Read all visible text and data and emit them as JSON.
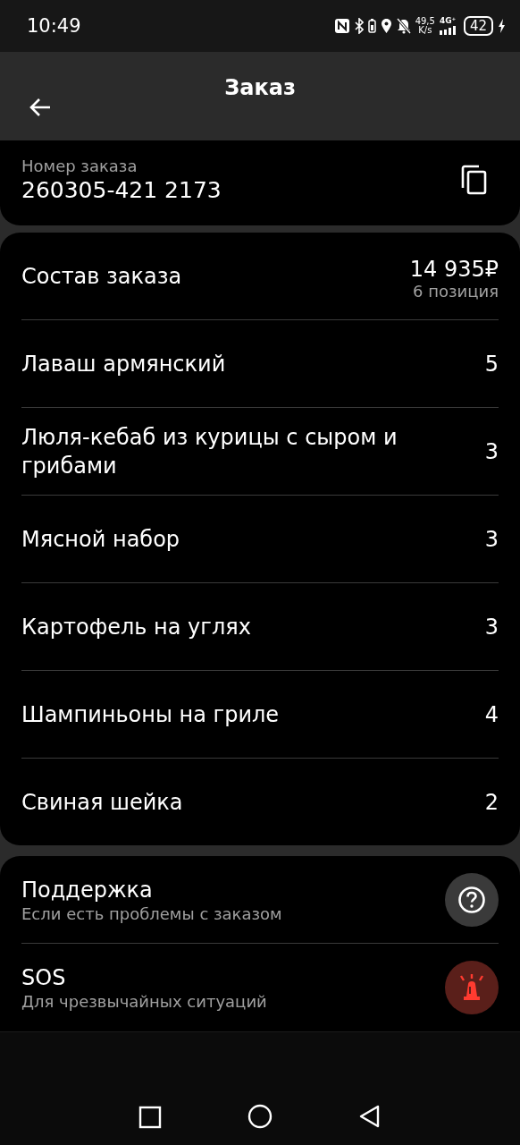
{
  "status_bar": {
    "time": "10:49",
    "speed": "49,5",
    "speed_unit": "K/s",
    "network": "4G⁺",
    "battery": "42"
  },
  "header": {
    "title": "Заказ"
  },
  "order_number": {
    "label": "Номер заказа",
    "value": "260305-421 2173"
  },
  "order": {
    "title": "Состав заказа",
    "total": "14 935₽",
    "count": "6 позиция",
    "items": [
      {
        "name": "Лаваш армянский",
        "qty": "5"
      },
      {
        "name": "Люля-кебаб из курицы с сыром и грибами",
        "qty": "3"
      },
      {
        "name": "Мясной набор",
        "qty": "3"
      },
      {
        "name": "Картофель на углях",
        "qty": "3"
      },
      {
        "name": "Шампиньоны на гриле",
        "qty": "4"
      },
      {
        "name": "Свиная шейка",
        "qty": "2"
      }
    ]
  },
  "help": [
    {
      "kind": "support",
      "title": "Поддержка",
      "subtitle": "Если есть проблемы с заказом"
    },
    {
      "kind": "sos",
      "title": "SOS",
      "subtitle": "Для чрезвычайных ситуаций"
    }
  ]
}
